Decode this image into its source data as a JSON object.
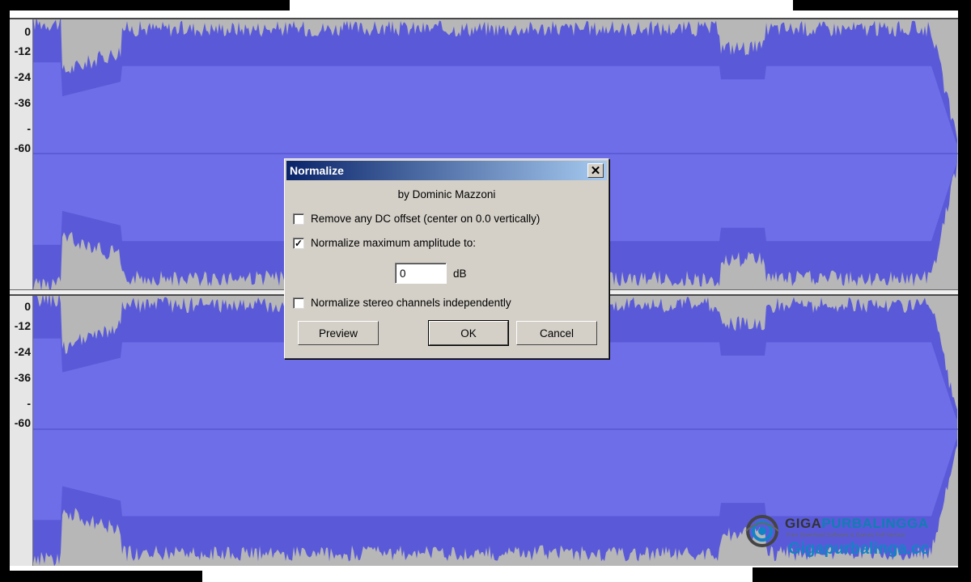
{
  "tracks": [
    {
      "ruler": [
        "0",
        "-12",
        "-24",
        "-36",
        "-",
        "-60"
      ]
    },
    {
      "ruler": [
        "0",
        "-12",
        "-24",
        "-36",
        "-",
        "-60"
      ]
    }
  ],
  "colors": {
    "waveform": "#5a5ad9",
    "waveform_core": "#6e6ee8",
    "track_bg": "#b7b7b7"
  },
  "dialog": {
    "title": "Normalize",
    "close_icon": "close-icon",
    "author": "by Dominic Mazzoni",
    "options": [
      {
        "label": "Remove any DC offset (center on 0.0 vertically)",
        "checked": false
      },
      {
        "label": "Normalize maximum amplitude to:",
        "checked": true
      },
      {
        "label": "Normalize stereo channels independently",
        "checked": false
      }
    ],
    "amplitude_value": "0",
    "amplitude_unit": "dB",
    "buttons": {
      "preview": "Preview",
      "ok": "OK",
      "cancel": "Cancel"
    }
  },
  "watermark": {
    "brand_part1": "GIGA",
    "brand_part2": "PURBALINGGA",
    "tagline": "Free Download Software & Games Full Version",
    "url": "Gigapurbalinga.cc"
  }
}
